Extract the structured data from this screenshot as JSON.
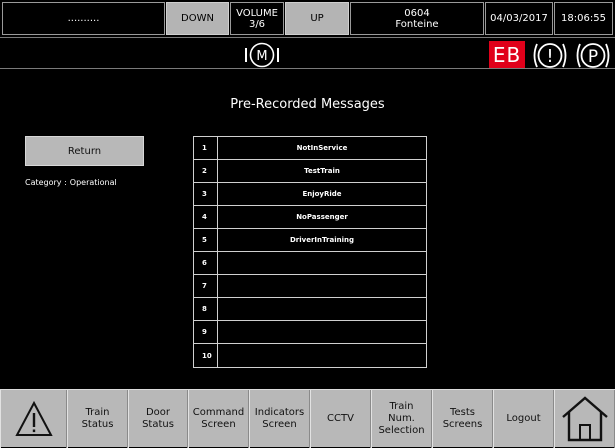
{
  "topbar": {
    "status_text": "..........",
    "down_label": "DOWN",
    "volume_label": "VOLUME",
    "volume_value": "3/6",
    "up_label": "UP",
    "train_number": "0604",
    "station": "Fonteine",
    "date": "04/03/2017",
    "time": "18:06:55"
  },
  "indicators": {
    "motor_label": "M",
    "eb_label": "EB",
    "warning_label": "!",
    "parking_label": "P",
    "eb_color": "#e0001a"
  },
  "main": {
    "title": "Pre-Recorded Messages",
    "return_label": "Return",
    "category_label": "Category :",
    "category_value": "Operational",
    "messages": [
      {
        "num": "1",
        "name": "NotInService"
      },
      {
        "num": "2",
        "name": "TestTrain"
      },
      {
        "num": "3",
        "name": "EnjoyRide"
      },
      {
        "num": "4",
        "name": "NoPassenger"
      },
      {
        "num": "5",
        "name": "DriverInTraining"
      },
      {
        "num": "6",
        "name": ""
      },
      {
        "num": "7",
        "name": ""
      },
      {
        "num": "8",
        "name": ""
      },
      {
        "num": "9",
        "name": ""
      },
      {
        "num": "10",
        "name": ""
      }
    ]
  },
  "nav": {
    "alarm_icon": "warning-triangle-icon",
    "train_status": "Train\nStatus",
    "door_status": "Door\nStatus",
    "command_screen": "Command\nScreen",
    "indicators_screen": "Indicators\nScreen",
    "cctv": "CCTV",
    "train_num_selection": "Train\nNum.\nSelection",
    "tests_screens": "Tests\nScreens",
    "logout": "Logout",
    "home_icon": "home-icon"
  }
}
